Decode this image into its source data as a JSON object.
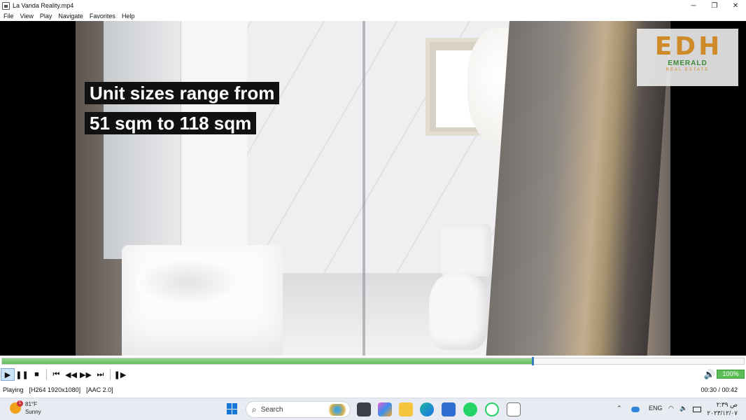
{
  "window": {
    "title": "La Vanda Reality.mp4",
    "controls": {
      "minimize": "─",
      "maximize": "❐",
      "close": "✕"
    }
  },
  "menu": [
    "File",
    "View",
    "Play",
    "Navigate",
    "Favorites",
    "Help"
  ],
  "video": {
    "caption_line1": "Unit sizes range from",
    "caption_line2": "51 sqm to 118 sqm",
    "logo_mark": "EDH",
    "logo_brand": "EMERALD",
    "logo_sub": "REAL ESTATE"
  },
  "seek": {
    "progress_fraction": 0.714
  },
  "controls": {
    "play": "▶",
    "pause": "❚❚",
    "stop": "■",
    "prev": "⏮",
    "rewind": "◀◀",
    "forward": "▶▶",
    "next": "⏭",
    "frame_step": "❚▶",
    "volume_icon": "🔊",
    "volume_label": "100%"
  },
  "status": {
    "state": "Playing",
    "video_info": "[H264 1920x1080]",
    "audio_info": "[AAC 2.0]",
    "time": "00:30 / 00:42"
  },
  "taskbar": {
    "weather_temp": "81°F",
    "weather_desc": "Sunny",
    "weather_badge": "1",
    "search_placeholder": "Search",
    "lang": "ENG",
    "clock_time": "ﺹ ۲:۳٩",
    "clock_date": "۲٠۲۳/۱۲/۰۷"
  },
  "colors": {
    "accent": "#1677d9",
    "seek_fill": "#66bd61",
    "logo_orange": "#cf8a2a",
    "logo_green": "#3d8a3a"
  }
}
